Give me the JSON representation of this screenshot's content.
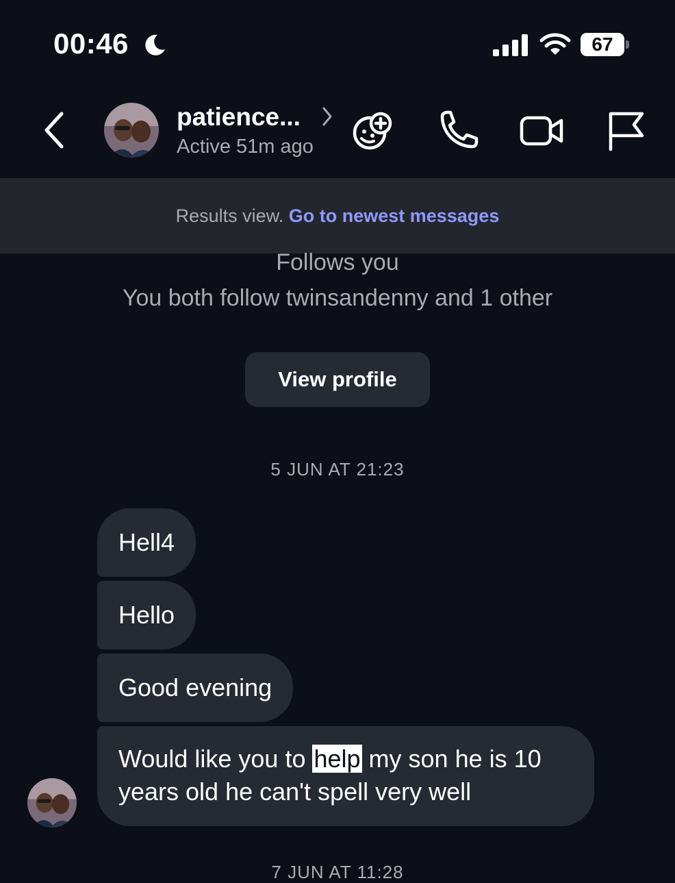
{
  "status_bar": {
    "time": "00:46",
    "battery": "67",
    "icons": [
      "moon-icon",
      "signal-icon",
      "wifi-icon",
      "battery-icon"
    ]
  },
  "header": {
    "contact_name": "patience...",
    "status": "Active 51m ago",
    "icons": [
      "back-chevron-icon",
      "chevron-right-icon",
      "game-icon",
      "phone-icon",
      "video-camera-icon",
      "flag-icon"
    ]
  },
  "results_banner": {
    "text": "Results view.",
    "link": "Go to newest messages"
  },
  "profile_info": {
    "follows": "Follows you",
    "mutual": "You both follow twinsandenny and 1 other",
    "button": "View profile"
  },
  "dates": [
    "5 JUN AT 21:23",
    "7 JUN AT 11:28"
  ],
  "messages": [
    {
      "text": "Hell4"
    },
    {
      "text": "Hello"
    },
    {
      "text": "Good evening"
    },
    {
      "before": "Would like you to ",
      "highlight": "help",
      "after": " my son he is 10 years old he can't spell very well"
    }
  ],
  "colors": {
    "background": "#0c0f17",
    "bubble": "#262a32",
    "banner": "#23262d",
    "link": "#8e99ff",
    "secondary_text": "#a8abb2"
  }
}
